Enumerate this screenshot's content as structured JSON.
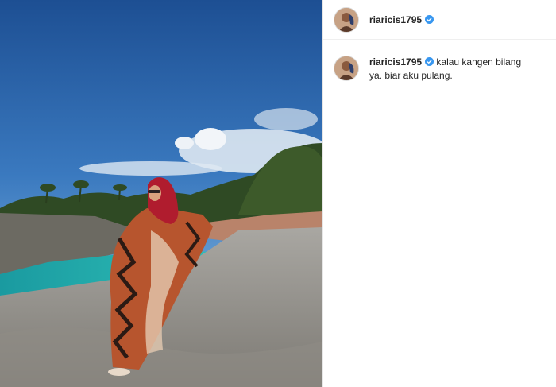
{
  "post": {
    "image_alt": "Woman in red hijab and patterned dress on rocky cliff by turquoise sea",
    "author": {
      "username": "riaricis1795",
      "verified": true,
      "avatar_icon": "profile-avatar"
    },
    "caption": {
      "username": "riaricis1795",
      "text": "kalau kangen bilang ya. biar aku pulang."
    }
  },
  "colors": {
    "verified_badge": "#3897f0",
    "text": "#262626",
    "border": "#efefef"
  }
}
